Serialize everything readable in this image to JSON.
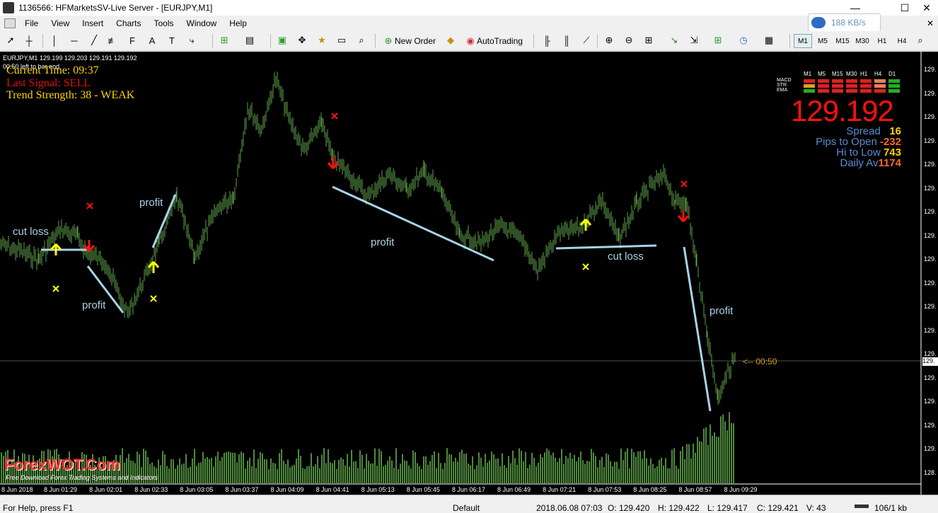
{
  "window": {
    "title": "1136566: HFMarketsSV-Live Server - [EURJPY,M1]",
    "minimize": "—",
    "maximize": "☐",
    "close": "✕"
  },
  "menu": [
    "File",
    "View",
    "Insert",
    "Charts",
    "Tools",
    "Window",
    "Help"
  ],
  "network": {
    "speed": "188 KB/s",
    "icon": "cloud-icon"
  },
  "toolbar": {
    "new_order": "New Order",
    "autotrading": "AutoTrading",
    "text_tool": "A",
    "timeframes": [
      "M1",
      "M5",
      "M15",
      "M30",
      "H1",
      "H4"
    ],
    "active_timeframe": "M1"
  },
  "chart": {
    "symbol_line": "EURJPY,M1  129.199 129.203 129.191 129.192",
    "left_secs": "00:50 left to bar end",
    "current_time": "Current Time: 09:37",
    "last_signal": "Last Signal: SELL",
    "trend_strength": "Trend Strength: 38 - WEAK",
    "tf_labels": [
      "M1",
      "M5",
      "M15",
      "M30",
      "H1",
      "H4",
      "D1"
    ],
    "indicator_labels": [
      "MACD",
      "STR",
      "EMA"
    ],
    "indicator_grid": [
      [
        "red",
        "red",
        "red",
        "red",
        "red",
        "salmon",
        "green"
      ],
      [
        "orange",
        "red",
        "red",
        "red",
        "red",
        "salmon",
        "green"
      ],
      [
        "green",
        "red",
        "red",
        "red",
        "red",
        "red",
        "green"
      ]
    ],
    "big_price": "129.192",
    "stats": {
      "spread_label": "Spread",
      "spread_value": "16",
      "pips_label": "Pips to Open",
      "pips_value": "-232",
      "hilo_label": "Hi to Low",
      "hilo_value": "743",
      "daily_label": "Daily Av",
      "daily_value": "1174"
    },
    "annotations": {
      "cut_loss_1": "cut loss",
      "profit_1": "profit",
      "profit_2": "profit",
      "profit_3": "profit",
      "cut_loss_2": "cut loss",
      "profit_4": "profit"
    },
    "countdown": "<-- 00:50",
    "watermark": "ForexWOT.Com",
    "watermark_sub": "Free Download Forex Trading Systems and Indicators",
    "price_axis_label": "129.",
    "date_labels": [
      "8 Jun 2018",
      "8 Jun 01:29",
      "8 Jun 02:01",
      "8 Jun 02:33",
      "8 Jun 03:05",
      "8 Jun 03:37",
      "8 Jun 04:09",
      "8 Jun 04:41",
      "8 Jun 05:13",
      "8 Jun 05:45",
      "8 Jun 06:17",
      "8 Jun 06:49",
      "8 Jun 07:21",
      "8 Jun 07:53",
      "8 Jun 08:25",
      "8 Jun 08:57",
      "8 Jun 09:29"
    ],
    "price_marker": "129.",
    "bottom_price_label": "128."
  },
  "status": {
    "help": "For Help, press F1",
    "profile": "Default",
    "datetime": "2018.06.08 07:03",
    "open": "O: 129.420",
    "high": "H: 129.422",
    "low": "L: 129.417",
    "close": "C: 129.421",
    "volume": "V: 43",
    "traffic": "106/1 kb"
  },
  "colors": {
    "up_arrow": "#ffff00",
    "down_arrow": "#ff1010",
    "price_line": "#5fa04a",
    "trend_line": "#a9d2e6",
    "volume": "#4f8a3e"
  }
}
